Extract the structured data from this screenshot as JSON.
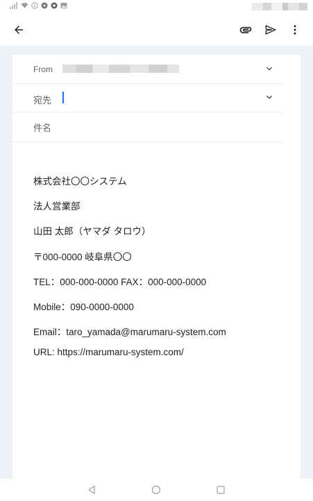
{
  "header": {
    "back_icon": "arrow-back-icon",
    "attach_icon": "paperclip-icon",
    "send_icon": "send-icon",
    "more_icon": "more-vert-icon"
  },
  "compose": {
    "from_label": "From",
    "to_label": "宛先",
    "subject_label": "件名",
    "body_lines": [
      "株式会社〇〇システム",
      "法人営業部",
      "山田 太郎（ヤマダ タロウ）",
      "〒000-0000 岐阜県〇〇",
      "TEL：000-000-0000 FAX：000-000-0000",
      "Mobile：090-0000-0000",
      "Email：taro_yamada@marumaru-system.com",
      "URL: https://marumaru-system.com/"
    ]
  },
  "colors": {
    "background": "#eef1f8",
    "card": "#ffffff",
    "cursor": "#1a73e8"
  }
}
